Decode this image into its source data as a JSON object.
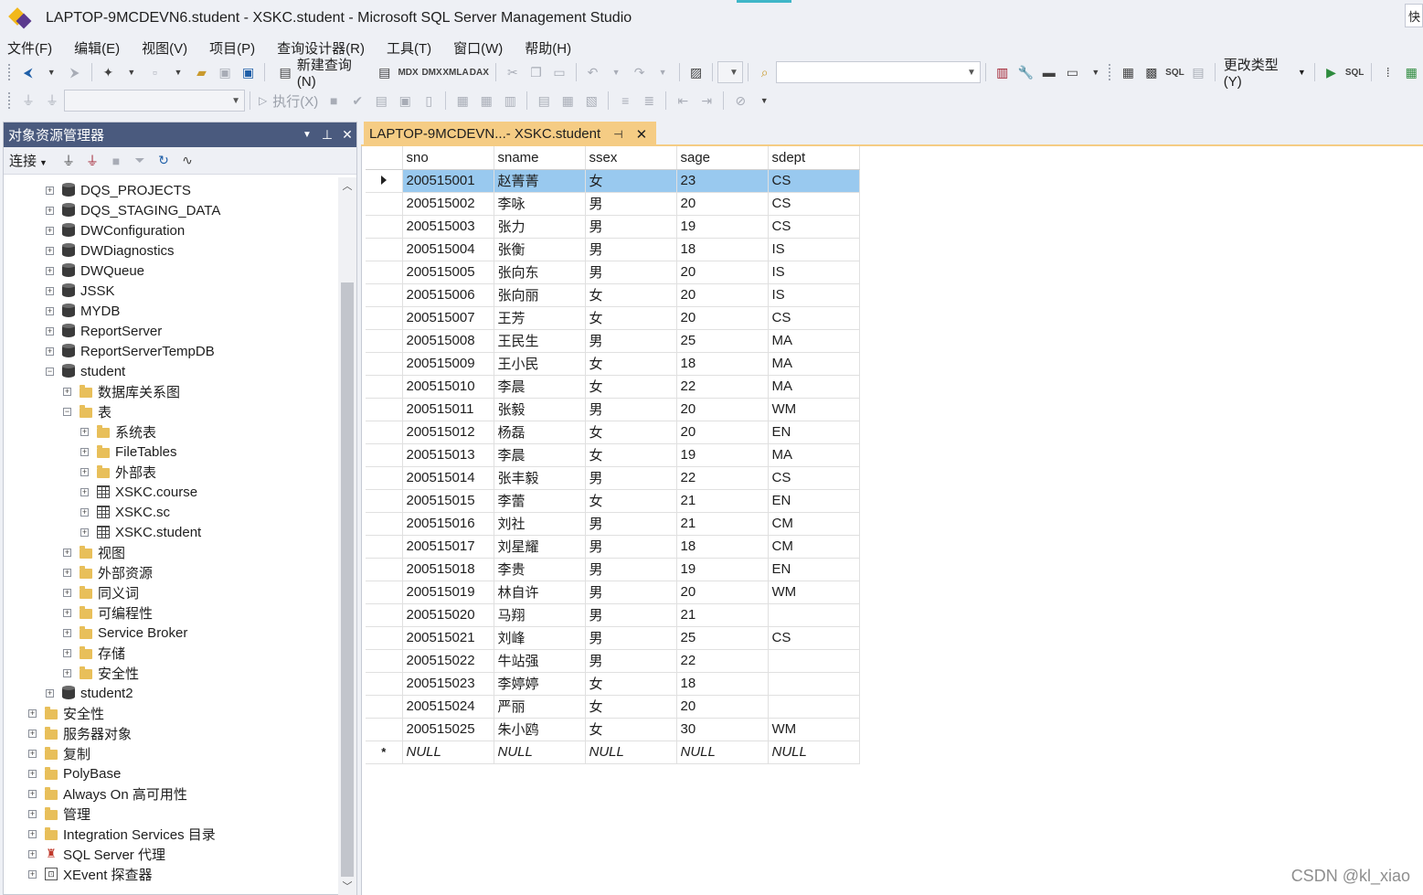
{
  "window": {
    "title": "LAPTOP-9MCDEVN6.student - XSKC.student - Microsoft SQL Server Management Studio",
    "quick_launch": "快"
  },
  "menu": [
    "文件(F)",
    "编辑(E)",
    "视图(V)",
    "项目(P)",
    "查询设计器(R)",
    "工具(T)",
    "窗口(W)",
    "帮助(H)"
  ],
  "toolbar": {
    "new_query": "新建查询(N)",
    "execute": "执行(X)",
    "change_type": "更改类型(Y)",
    "labels": {
      "mdx": "MDX",
      "dmx": "DMX",
      "xmla": "XMLA",
      "dax": "DAX",
      "sql": "SQL"
    }
  },
  "object_explorer": {
    "title": "对象资源管理器",
    "connect": "连接",
    "nodes": [
      {
        "label": "DQS_PROJECTS",
        "icon": "database-icon",
        "indent": 2,
        "exp": "+"
      },
      {
        "label": "DQS_STAGING_DATA",
        "icon": "database-icon",
        "indent": 2,
        "exp": "+"
      },
      {
        "label": "DWConfiguration",
        "icon": "database-icon",
        "indent": 2,
        "exp": "+"
      },
      {
        "label": "DWDiagnostics",
        "icon": "database-icon",
        "indent": 2,
        "exp": "+"
      },
      {
        "label": "DWQueue",
        "icon": "database-icon",
        "indent": 2,
        "exp": "+"
      },
      {
        "label": "JSSK",
        "icon": "database-icon",
        "indent": 2,
        "exp": "+"
      },
      {
        "label": "MYDB",
        "icon": "database-icon",
        "indent": 2,
        "exp": "+"
      },
      {
        "label": "ReportServer",
        "icon": "database-icon",
        "indent": 2,
        "exp": "+"
      },
      {
        "label": "ReportServerTempDB",
        "icon": "database-icon",
        "indent": 2,
        "exp": "+"
      },
      {
        "label": "student",
        "icon": "database-icon",
        "indent": 2,
        "exp": "-"
      },
      {
        "label": "数据库关系图",
        "icon": "folder-icon",
        "indent": 3,
        "exp": "+"
      },
      {
        "label": "表",
        "icon": "folder-icon",
        "indent": 3,
        "exp": "-"
      },
      {
        "label": "系统表",
        "icon": "folder-icon",
        "indent": 4,
        "exp": "+"
      },
      {
        "label": "FileTables",
        "icon": "folder-icon",
        "indent": 4,
        "exp": "+"
      },
      {
        "label": "外部表",
        "icon": "folder-icon",
        "indent": 4,
        "exp": "+"
      },
      {
        "label": "XSKC.course",
        "icon": "table-icon",
        "indent": 4,
        "exp": "+"
      },
      {
        "label": "XSKC.sc",
        "icon": "table-icon",
        "indent": 4,
        "exp": "+"
      },
      {
        "label": "XSKC.student",
        "icon": "table-icon",
        "indent": 4,
        "exp": "+"
      },
      {
        "label": "视图",
        "icon": "folder-icon",
        "indent": 3,
        "exp": "+"
      },
      {
        "label": "外部资源",
        "icon": "folder-icon",
        "indent": 3,
        "exp": "+"
      },
      {
        "label": "同义词",
        "icon": "folder-icon",
        "indent": 3,
        "exp": "+"
      },
      {
        "label": "可编程性",
        "icon": "folder-icon",
        "indent": 3,
        "exp": "+"
      },
      {
        "label": "Service Broker",
        "icon": "folder-icon",
        "indent": 3,
        "exp": "+"
      },
      {
        "label": "存储",
        "icon": "folder-icon",
        "indent": 3,
        "exp": "+"
      },
      {
        "label": "安全性",
        "icon": "folder-icon",
        "indent": 3,
        "exp": "+"
      },
      {
        "label": "student2",
        "icon": "database-icon",
        "indent": 2,
        "exp": "+"
      },
      {
        "label": "安全性",
        "icon": "folder-icon",
        "indent": 1,
        "exp": "+"
      },
      {
        "label": "服务器对象",
        "icon": "folder-icon",
        "indent": 1,
        "exp": "+"
      },
      {
        "label": "复制",
        "icon": "folder-icon",
        "indent": 1,
        "exp": "+"
      },
      {
        "label": "PolyBase",
        "icon": "folder-icon",
        "indent": 1,
        "exp": "+"
      },
      {
        "label": "Always On 高可用性",
        "icon": "folder-icon",
        "indent": 1,
        "exp": "+"
      },
      {
        "label": "管理",
        "icon": "folder-icon",
        "indent": 1,
        "exp": "+"
      },
      {
        "label": "Integration Services 目录",
        "icon": "folder-icon",
        "indent": 1,
        "exp": "+"
      },
      {
        "label": "SQL Server 代理",
        "icon": "agent-icon",
        "indent": 1,
        "exp": "+"
      },
      {
        "label": "XEvent 探查器",
        "icon": "xevent-icon",
        "indent": 1,
        "exp": "+"
      }
    ]
  },
  "document": {
    "tab_title": "LAPTOP-9MCDEVN...- XSKC.student",
    "columns": [
      "sno",
      "sname",
      "ssex",
      "sage",
      "sdept"
    ],
    "rows": [
      [
        "200515001",
        "赵菁菁",
        "女",
        "23",
        "CS"
      ],
      [
        "200515002",
        "李咏",
        "男",
        "20",
        "CS"
      ],
      [
        "200515003",
        "张力",
        "男",
        "19",
        "CS"
      ],
      [
        "200515004",
        "张衡",
        "男",
        "18",
        "IS"
      ],
      [
        "200515005",
        "张向东",
        "男",
        "20",
        "IS"
      ],
      [
        "200515006",
        "张向丽",
        "女",
        "20",
        "IS"
      ],
      [
        "200515007",
        "王芳",
        "女",
        "20",
        "CS"
      ],
      [
        "200515008",
        "王民生",
        "男",
        "25",
        "MA"
      ],
      [
        "200515009",
        "王小民",
        "女",
        "18",
        "MA"
      ],
      [
        "200515010",
        "李晨",
        "女",
        "22",
        "MA"
      ],
      [
        "200515011",
        "张毅",
        "男",
        "20",
        "WM"
      ],
      [
        "200515012",
        "杨磊",
        "女",
        "20",
        "EN"
      ],
      [
        "200515013",
        "李晨",
        "女",
        "19",
        "MA"
      ],
      [
        "200515014",
        "张丰毅",
        "男",
        "22",
        "CS"
      ],
      [
        "200515015",
        "李蕾",
        "女",
        "21",
        "EN"
      ],
      [
        "200515016",
        "刘社",
        "男",
        "21",
        "CM"
      ],
      [
        "200515017",
        "刘星耀",
        "男",
        "18",
        "CM"
      ],
      [
        "200515018",
        "李贵",
        "男",
        "19",
        "EN"
      ],
      [
        "200515019",
        "林自许",
        "男",
        "20",
        "WM"
      ],
      [
        "200515020",
        "马翔",
        "男",
        "21",
        ""
      ],
      [
        "200515021",
        "刘峰",
        "男",
        "25",
        "CS"
      ],
      [
        "200515022",
        "牛站强",
        "男",
        "22",
        ""
      ],
      [
        "200515023",
        "李婷婷",
        "女",
        "18",
        ""
      ],
      [
        "200515024",
        "严丽",
        "女",
        "20",
        ""
      ],
      [
        "200515025",
        "朱小鸥",
        "女",
        "30",
        "WM"
      ]
    ],
    "new_row": [
      "NULL",
      "NULL",
      "NULL",
      "NULL",
      "NULL"
    ],
    "selected_row": 0
  },
  "watermark": "CSDN @kl_xiao",
  "colors": {
    "panel_header": "#4a5a7e",
    "tab_active": "#f5cc84",
    "row_selected": "#99c9ef"
  }
}
